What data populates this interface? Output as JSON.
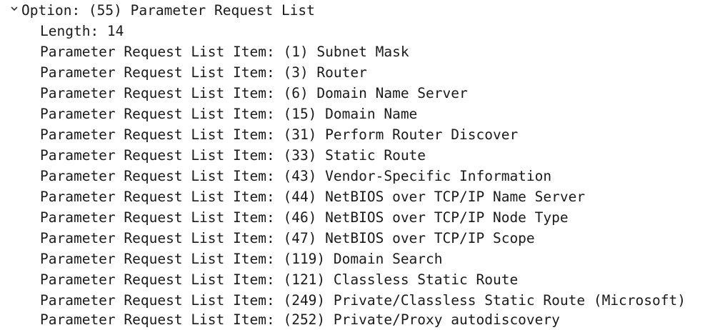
{
  "tree": {
    "header": {
      "label": "Option: (55) Parameter Request List",
      "expanded": true
    },
    "length": "Length: 14",
    "items": [
      "Parameter Request List Item: (1) Subnet Mask",
      "Parameter Request List Item: (3) Router",
      "Parameter Request List Item: (6) Domain Name Server",
      "Parameter Request List Item: (15) Domain Name",
      "Parameter Request List Item: (31) Perform Router Discover",
      "Parameter Request List Item: (33) Static Route",
      "Parameter Request List Item: (43) Vendor-Specific Information",
      "Parameter Request List Item: (44) NetBIOS over TCP/IP Name Server",
      "Parameter Request List Item: (46) NetBIOS over TCP/IP Node Type",
      "Parameter Request List Item: (47) NetBIOS over TCP/IP Scope",
      "Parameter Request List Item: (119) Domain Search",
      "Parameter Request List Item: (121) Classless Static Route",
      "Parameter Request List Item: (249) Private/Classless Static Route (Microsoft)",
      "Parameter Request List Item: (252) Private/Proxy autodiscovery"
    ]
  }
}
